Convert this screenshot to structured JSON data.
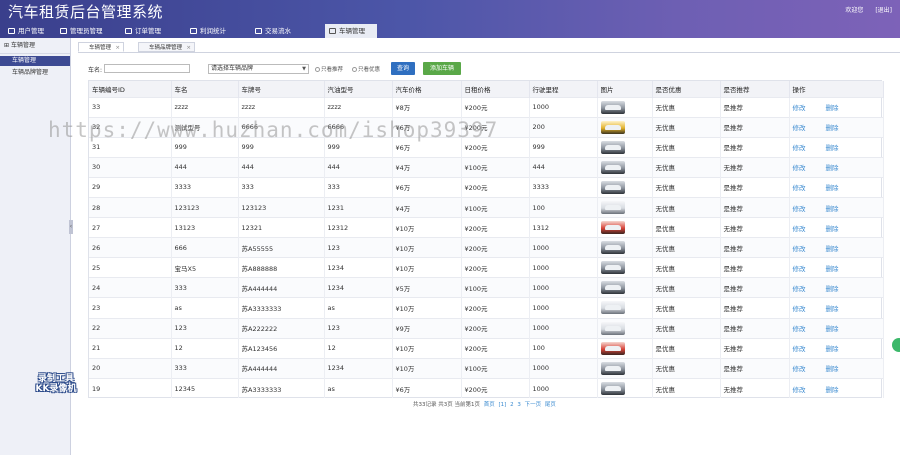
{
  "header": {
    "title": "汽车租赁后台管理系统",
    "welcome": "欢迎您",
    "logout": "[退出]"
  },
  "nav": [
    {
      "label": "用户管理",
      "active": false
    },
    {
      "label": "管理员管理",
      "active": false
    },
    {
      "label": "订单管理",
      "active": false
    },
    {
      "label": "利润统计",
      "active": false
    },
    {
      "label": "交易流水",
      "active": false
    },
    {
      "label": "车辆管理",
      "active": true
    }
  ],
  "sidebar": {
    "title": "车辆管理",
    "items": [
      {
        "label": "车辆管理",
        "active": true
      },
      {
        "label": "车辆品牌管理",
        "active": false
      }
    ]
  },
  "tabs": [
    {
      "label": "车辆管理",
      "active": true
    },
    {
      "label": "车辆品牌管理",
      "active": false
    }
  ],
  "search": {
    "label": "车名:",
    "value": "",
    "brand_select": "请选择车辆品牌",
    "check_recommend": "只看推荐",
    "check_discount": "只看优惠",
    "query_button": "查询",
    "add_button": "添加车辆"
  },
  "table": {
    "columns": [
      "车辆编号ID",
      "车名",
      "车牌号",
      "汽油型号",
      "汽车价格",
      "日租价格",
      "行驶里程",
      "图片",
      "是否优惠",
      "是否推荐",
      "操作"
    ],
    "edit_label": "修改",
    "delete_label": "删除",
    "rows": [
      {
        "id": "33",
        "name": "zzzz",
        "plate": "zzzz",
        "fuel": "zzzz",
        "price": "¥8万",
        "daily": "¥200元",
        "mileage": "1000",
        "img": "gray",
        "discount": "无优惠",
        "recommend": "是推荐"
      },
      {
        "id": "32",
        "name": "测试型号",
        "plate": "6666",
        "fuel": "6666",
        "price": "¥6万",
        "daily": "¥200元",
        "mileage": "200",
        "img": "yellow",
        "discount": "无优惠",
        "recommend": "是推荐"
      },
      {
        "id": "31",
        "name": "999",
        "plate": "999",
        "fuel": "999",
        "price": "¥6万",
        "daily": "¥200元",
        "mileage": "999",
        "img": "gray",
        "discount": "无优惠",
        "recommend": "是推荐"
      },
      {
        "id": "30",
        "name": "444",
        "plate": "444",
        "fuel": "444",
        "price": "¥4万",
        "daily": "¥100元",
        "mileage": "444",
        "img": "gray",
        "discount": "无优惠",
        "recommend": "无推荐"
      },
      {
        "id": "29",
        "name": "3333",
        "plate": "333",
        "fuel": "333",
        "price": "¥6万",
        "daily": "¥200元",
        "mileage": "3333",
        "img": "gray",
        "discount": "无优惠",
        "recommend": "是推荐"
      },
      {
        "id": "28",
        "name": "123123",
        "plate": "123123",
        "fuel": "1231",
        "price": "¥4万",
        "daily": "¥100元",
        "mileage": "100",
        "img": "white",
        "discount": "无优惠",
        "recommend": "是推荐"
      },
      {
        "id": "27",
        "name": "13123",
        "plate": "12321",
        "fuel": "12312",
        "price": "¥10万",
        "daily": "¥200元",
        "mileage": "1312",
        "img": "red",
        "discount": "是优惠",
        "recommend": "无推荐"
      },
      {
        "id": "26",
        "name": "666",
        "plate": "苏A55555",
        "fuel": "123",
        "price": "¥10万",
        "daily": "¥200元",
        "mileage": "1000",
        "img": "gray",
        "discount": "无优惠",
        "recommend": "是推荐"
      },
      {
        "id": "25",
        "name": "宝马X5",
        "plate": "苏A888888",
        "fuel": "1234",
        "price": "¥10万",
        "daily": "¥200元",
        "mileage": "1000",
        "img": "gray",
        "discount": "无优惠",
        "recommend": "是推荐"
      },
      {
        "id": "24",
        "name": "333",
        "plate": "苏A444444",
        "fuel": "1234",
        "price": "¥5万",
        "daily": "¥100元",
        "mileage": "1000",
        "img": "gray",
        "discount": "无优惠",
        "recommend": "是推荐"
      },
      {
        "id": "23",
        "name": "as",
        "plate": "苏A3333333",
        "fuel": "as",
        "price": "¥10万",
        "daily": "¥200元",
        "mileage": "1000",
        "img": "white",
        "discount": "无优惠",
        "recommend": "是推荐"
      },
      {
        "id": "22",
        "name": "123",
        "plate": "苏A222222",
        "fuel": "123",
        "price": "¥9万",
        "daily": "¥200元",
        "mileage": "1000",
        "img": "white",
        "discount": "无优惠",
        "recommend": "是推荐"
      },
      {
        "id": "21",
        "name": "12",
        "plate": "苏A123456",
        "fuel": "12",
        "price": "¥10万",
        "daily": "¥200元",
        "mileage": "100",
        "img": "red",
        "discount": "是优惠",
        "recommend": "无推荐"
      },
      {
        "id": "20",
        "name": "333",
        "plate": "苏A444444",
        "fuel": "1234",
        "price": "¥10万",
        "daily": "¥100元",
        "mileage": "1000",
        "img": "gray",
        "discount": "无优惠",
        "recommend": "是推荐"
      },
      {
        "id": "19",
        "name": "12345",
        "plate": "苏A3333333",
        "fuel": "as",
        "price": "¥6万",
        "daily": "¥200元",
        "mileage": "1000",
        "img": "gray",
        "discount": "无优惠",
        "recommend": "无推荐"
      }
    ]
  },
  "pager": {
    "summary": "共33记录 共3页 当前第1页",
    "first": "首页",
    "pages": [
      "[1]",
      "2",
      "3"
    ],
    "next": "下一页",
    "last": "尾页"
  },
  "overlay": {
    "watermark": "https://www.huzhan.com/ishop39397",
    "recorder_line1": "录制工具",
    "recorder_line2": "KK录像机"
  }
}
